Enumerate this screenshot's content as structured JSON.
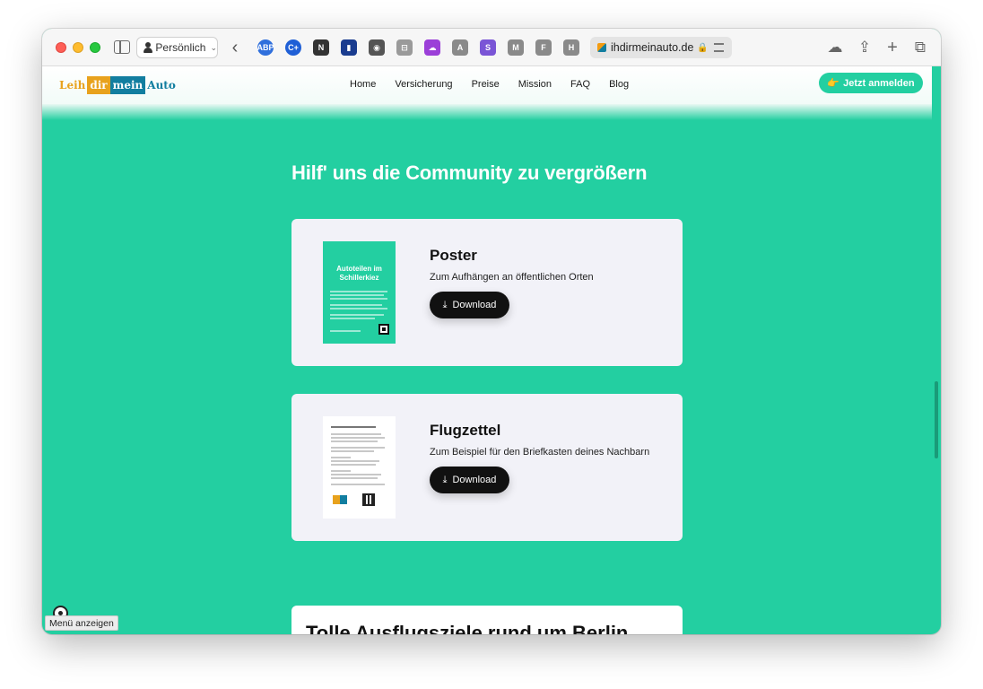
{
  "browser": {
    "profile_label": "Persönlich",
    "url_text": "ihdirmeinauto.de",
    "extensions": [
      {
        "label": "ABP",
        "color": "#2f6fdc"
      },
      {
        "label": "C+",
        "color": "#1f5fd6"
      },
      {
        "label": "N",
        "color": "#333333"
      },
      {
        "label": "▮",
        "color": "#1a3c8f"
      },
      {
        "label": "◉",
        "color": "#555555"
      },
      {
        "label": "⊟",
        "color": "#9a9a9a"
      },
      {
        "label": "☁",
        "color": "#9b3fd8"
      },
      {
        "label": "A",
        "color": "#8a8a8a"
      },
      {
        "label": "S",
        "color": "#7a55d6"
      },
      {
        "label": "M",
        "color": "#8a8a8a"
      },
      {
        "label": "F",
        "color": "#8a8a8a"
      },
      {
        "label": "H",
        "color": "#8a8a8a"
      }
    ]
  },
  "site": {
    "logo": {
      "part1": "Leih",
      "part2": "dir",
      "part3": "mein",
      "part4": "Auto"
    },
    "nav": [
      "Home",
      "Versicherung",
      "Preise",
      "Mission",
      "FAQ",
      "Blog"
    ],
    "cta_label": "Jetzt anmelden",
    "cta_icon": "👉"
  },
  "main": {
    "section_title": "Hilf' uns die Community zu vergrößern",
    "cards": [
      {
        "title": "Poster",
        "subtitle": "Zum Aufhängen an öffentlichen Orten",
        "button_label": "Download",
        "thumbnail_title": "Autoteilen im Schillerkiez"
      },
      {
        "title": "Flugzettel",
        "subtitle": "Zum Beispiel für den Briefkasten deines Nachbarn",
        "button_label": "Download"
      }
    ],
    "next_section_title": "Tolle Ausflugsziele rund um Berlin"
  },
  "overlay": {
    "menu_tooltip": "Menü anzeigen"
  }
}
